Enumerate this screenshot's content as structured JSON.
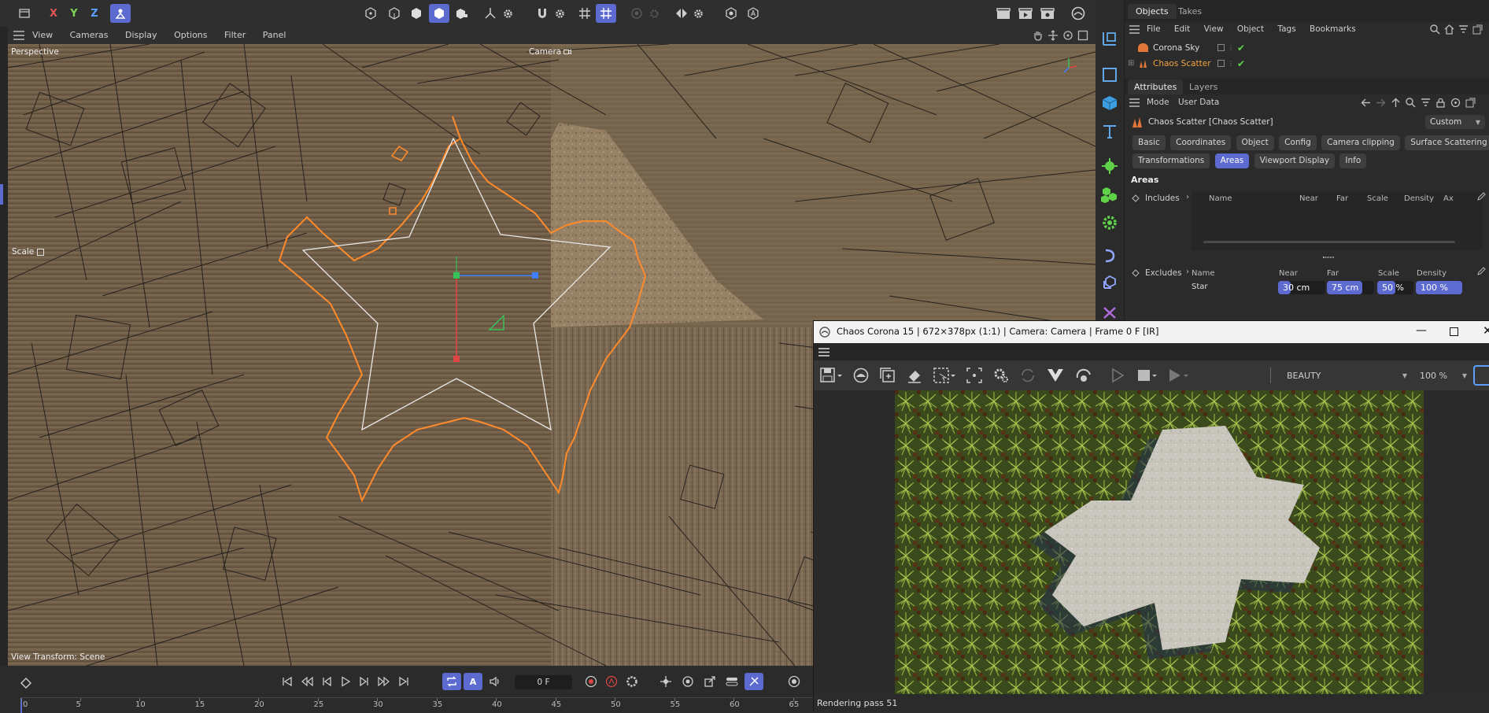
{
  "top_toolbar": {
    "axis_x": "X",
    "axis_y": "Y",
    "axis_z": "Z"
  },
  "viewport": {
    "menu": [
      "View",
      "Cameras",
      "Display",
      "Options",
      "Filter",
      "Panel"
    ],
    "label": "Perspective",
    "camera_label": "Camera",
    "scale_label": "Scale",
    "view_transform": "View Transform: Scene"
  },
  "timeline": {
    "frame_field": "0 F",
    "ticks": [
      "0",
      "5",
      "10",
      "15",
      "20",
      "25",
      "30",
      "35",
      "40",
      "45",
      "50",
      "55",
      "60",
      "65"
    ]
  },
  "objects_panel": {
    "tabs": [
      "Objects",
      "Takes"
    ],
    "menu": [
      "File",
      "Edit",
      "View",
      "Object",
      "Tags",
      "Bookmarks"
    ],
    "items": [
      {
        "name": "Corona Sky",
        "selected": false
      },
      {
        "name": "Chaos Scatter",
        "selected": true
      }
    ]
  },
  "attributes_panel": {
    "tabs": [
      "Attributes",
      "Layers"
    ],
    "mode_menu": [
      "Mode",
      "User Data"
    ],
    "object_title": "Chaos Scatter [Chaos Scatter]",
    "preset": "Custom",
    "tab_rows": [
      [
        "Basic",
        "Coordinates",
        "Object",
        "Config",
        "Camera clipping",
        "Surface Scattering"
      ],
      [
        "Transformations",
        "Areas",
        "Viewport Display",
        "Info"
      ]
    ],
    "active_tab": "Areas",
    "section_title": "Areas",
    "includes_label": "Includes",
    "includes_columns": [
      "Name",
      "Near",
      "Far",
      "Scale",
      "Density",
      "Ax"
    ],
    "excludes_label": "Excludes",
    "excludes_columns": [
      "Name",
      "Near",
      "Far",
      "Scale",
      "Density"
    ],
    "excludes_row": {
      "name": "Star",
      "near": "30 cm",
      "far": "75 cm",
      "scale": "50 %",
      "density": "100 %"
    }
  },
  "render_window": {
    "title": "Chaos Corona 15 | 672×378px (1:1) | Camera: Camera | Frame 0 F [IR]",
    "pass_select": "BEAUTY",
    "zoom": "100 %",
    "status": "Rendering pass 51"
  },
  "colors": {
    "accent": "#5d6bd0",
    "selection": "#ff8a2a",
    "panel_bg": "#2b2b2b",
    "toolbar_bg": "#2f2f2f"
  }
}
